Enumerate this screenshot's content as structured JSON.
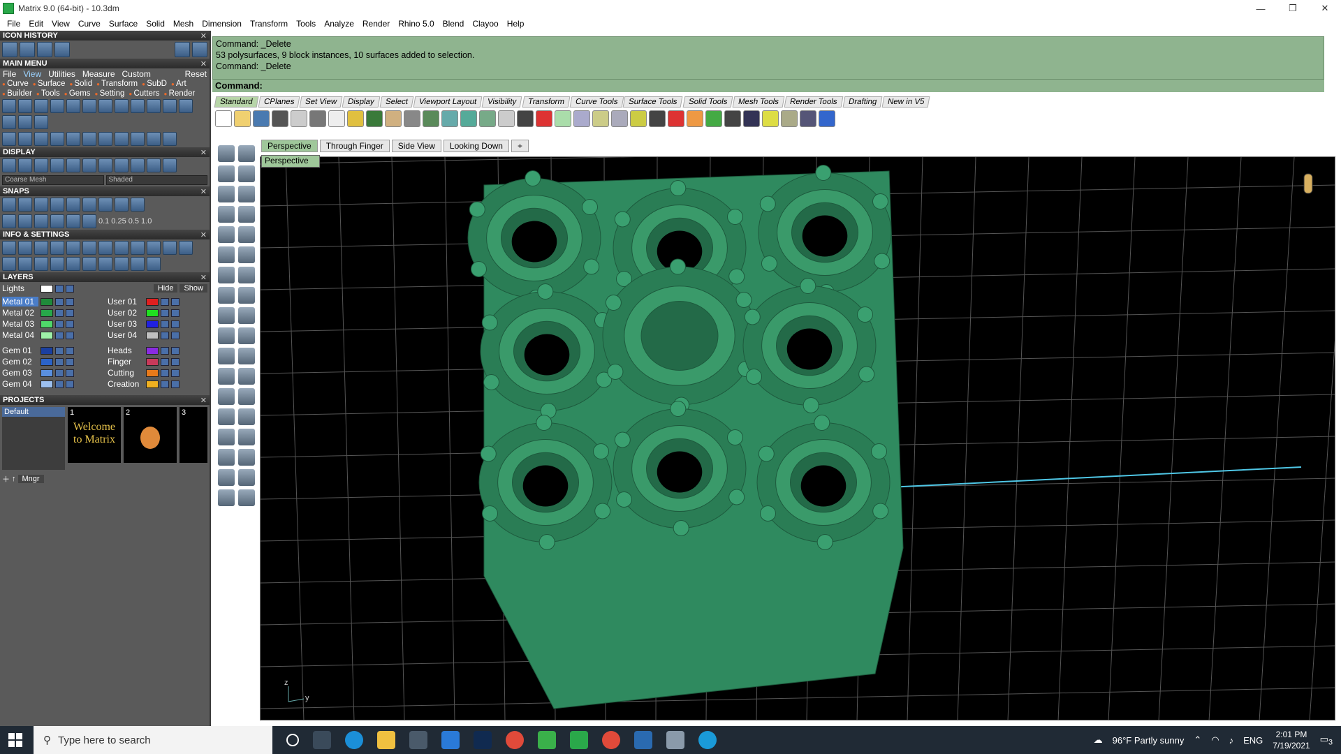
{
  "window": {
    "title": "Matrix 9.0 (64-bit) - 10.3dm",
    "minimize": "—",
    "maximize": "❐",
    "close": "✕"
  },
  "menubar": [
    "File",
    "Edit",
    "View",
    "Curve",
    "Surface",
    "Solid",
    "Mesh",
    "Dimension",
    "Transform",
    "Tools",
    "Analyze",
    "Render",
    "Rhino 5.0",
    "Blend",
    "Clayoo",
    "Help"
  ],
  "panels": {
    "icon_history": "ICON HISTORY",
    "main_menu": "MAIN MENU",
    "main_menu_items": [
      "File",
      "View",
      "Utilities",
      "Measure",
      "Custom",
      "Reset"
    ],
    "main_menu_tags": [
      "Curve",
      "Surface",
      "Solid",
      "Transform",
      "SubD",
      "Art",
      "Builder",
      "Tools",
      "Gems",
      "Setting",
      "Cutters",
      "Render"
    ],
    "display": "DISPLAY",
    "display_mesh": "Coarse Mesh",
    "display_mode": "Shaded",
    "snaps": "SNAPS",
    "snap_values": [
      "0.1",
      "0.25",
      "0.5",
      "1.0"
    ],
    "info": "INFO & SETTINGS",
    "layers": "LAYERS",
    "layers_lights": "Lights",
    "layers_hide": "Hide",
    "layers_show": "Show",
    "layers_left": [
      {
        "name": "Metal 01",
        "color": "#1f8a3a"
      },
      {
        "name": "Metal 02",
        "color": "#27a84a"
      },
      {
        "name": "Metal 03",
        "color": "#4fd86a"
      },
      {
        "name": "Metal 04",
        "color": "#9ef0a8"
      },
      {
        "name": "Gem 01",
        "color": "#1a3fa0"
      },
      {
        "name": "Gem 02",
        "color": "#2b63c8"
      },
      {
        "name": "Gem 03",
        "color": "#5a90e0"
      },
      {
        "name": "Gem 04",
        "color": "#9cc0f0"
      }
    ],
    "layers_right": [
      {
        "name": "User 01",
        "color": "#e02020"
      },
      {
        "name": "User 02",
        "color": "#20e020"
      },
      {
        "name": "User 03",
        "color": "#2020e0"
      },
      {
        "name": "User 04",
        "color": "#c0c0c0"
      },
      {
        "name": "Heads",
        "color": "#8a2be2"
      },
      {
        "name": "Finger",
        "color": "#c83a5a"
      },
      {
        "name": "Cutting",
        "color": "#e87a1a"
      },
      {
        "name": "Creation",
        "color": "#f0b020"
      }
    ],
    "projects": "PROJECTS",
    "project_default": "Default",
    "project_slots": [
      "1",
      "2",
      "3"
    ],
    "project_welcome": "Welcome to Matrix",
    "mngr": "Mngr"
  },
  "command": {
    "lines": [
      "Command: _Delete",
      "53 polysurfaces, 9 block instances, 10 surfaces added to selection.",
      "Command: _Delete"
    ],
    "prompt": "Command:"
  },
  "toolbar_tabs": [
    "Standard",
    "CPlanes",
    "Set View",
    "Display",
    "Select",
    "Viewport Layout",
    "Visibility",
    "Transform",
    "Curve Tools",
    "Surface Tools",
    "Solid Tools",
    "Mesh Tools",
    "Render Tools",
    "Drafting",
    "New in V5"
  ],
  "viewport_tabs": [
    "Perspective",
    "Through Finger",
    "Side View",
    "Looking Down",
    "+"
  ],
  "viewport_label": "Perspective",
  "axes": {
    "z": "z",
    "y": "y"
  },
  "taskbar": {
    "search_placeholder": "Type here to search",
    "weather": "96°F  Partly sunny",
    "lang": "ENG",
    "time": "2:01 PM",
    "date": "7/19/2021",
    "notif": "3"
  },
  "colors": {
    "model": "#2f8a5f",
    "command_bg": "#8fb48f",
    "panel_bg": "#5a5a5a"
  }
}
